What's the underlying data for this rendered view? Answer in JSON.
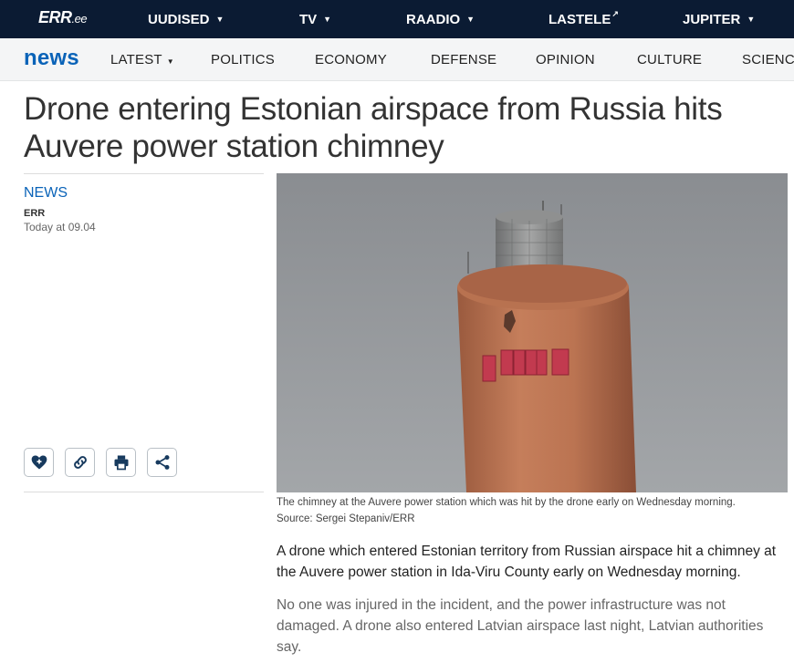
{
  "topbar": {
    "logo": "ERR",
    "logo_suffix": ".ee",
    "items": [
      {
        "label": "UUDISED",
        "caret": "▼"
      },
      {
        "label": "TV",
        "caret": "▼"
      },
      {
        "label": "RAADIO",
        "caret": "▼"
      },
      {
        "label": "LASTELE",
        "ext": "↗"
      },
      {
        "label": "JUPITER",
        "caret": "▼"
      }
    ]
  },
  "secnav": {
    "brand": "news",
    "items": [
      {
        "label": "LATEST",
        "caret": "▼"
      },
      {
        "label": "POLITICS"
      },
      {
        "label": "ECONOMY"
      },
      {
        "label": "DEFENSE"
      },
      {
        "label": "OPINION"
      },
      {
        "label": "CULTURE"
      },
      {
        "label": "SCIENCE"
      }
    ]
  },
  "article": {
    "headline": "Drone entering Estonian airspace from Russia hits Auvere power station chimney",
    "category": "NEWS",
    "author": "ERR",
    "datetime": "Today at 09.04",
    "caption": "The chimney at the Auvere power station which was hit by the drone early on Wednesday morning.",
    "source": "Source: Sergei Stepaniv/ERR",
    "lead": "A drone which entered Estonian territory from Russian airspace hit a chimney at the Auvere power station in Ida-Viru County early on Wednesday morning.",
    "paragraph": "No one was injured in the incident, and the power infrastructure was not damaged. A drone also entered Latvian airspace last night, Latvian authorities say."
  },
  "actions": {
    "icons": [
      "heart-icon",
      "link-icon",
      "print-icon",
      "share-icon"
    ]
  },
  "colors": {
    "topbar_bg": "#0b1b33",
    "accent": "#0a63b8",
    "secbar_bg": "#f4f5f6"
  }
}
